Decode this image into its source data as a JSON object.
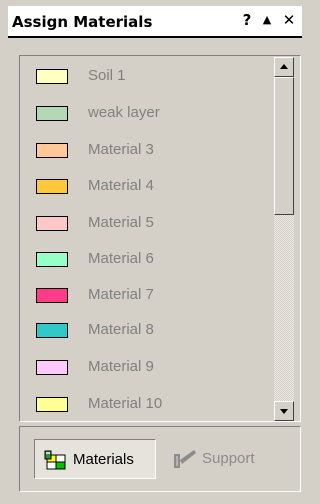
{
  "window": {
    "title": "Assign Materials",
    "help_glyph": "?",
    "collapse_glyph": "▲",
    "close_glyph": "✕"
  },
  "materials": {
    "items": [
      {
        "label": "Soil 1",
        "color": "#ffffc0"
      },
      {
        "label": "weak layer",
        "color": "#b4d7b4"
      },
      {
        "label": "Material 3",
        "color": "#ffc896"
      },
      {
        "label": "Material 4",
        "color": "#ffc83c"
      },
      {
        "label": "Material 5",
        "color": "#ffc8c8"
      },
      {
        "label": "Material 6",
        "color": "#96ffc8"
      },
      {
        "label": "Material 7",
        "color": "#ff3c8c"
      },
      {
        "label": "Material 8",
        "color": "#32c8c8"
      },
      {
        "label": "Material 9",
        "color": "#ffc8ff"
      },
      {
        "label": "Material 10",
        "color": "#ffff96"
      }
    ]
  },
  "tabs": {
    "materials_label": "Materials",
    "materials_icon": "materials-palette-icon",
    "support_label": "Support",
    "support_icon": "support-bolt-icon",
    "active": "Materials"
  }
}
